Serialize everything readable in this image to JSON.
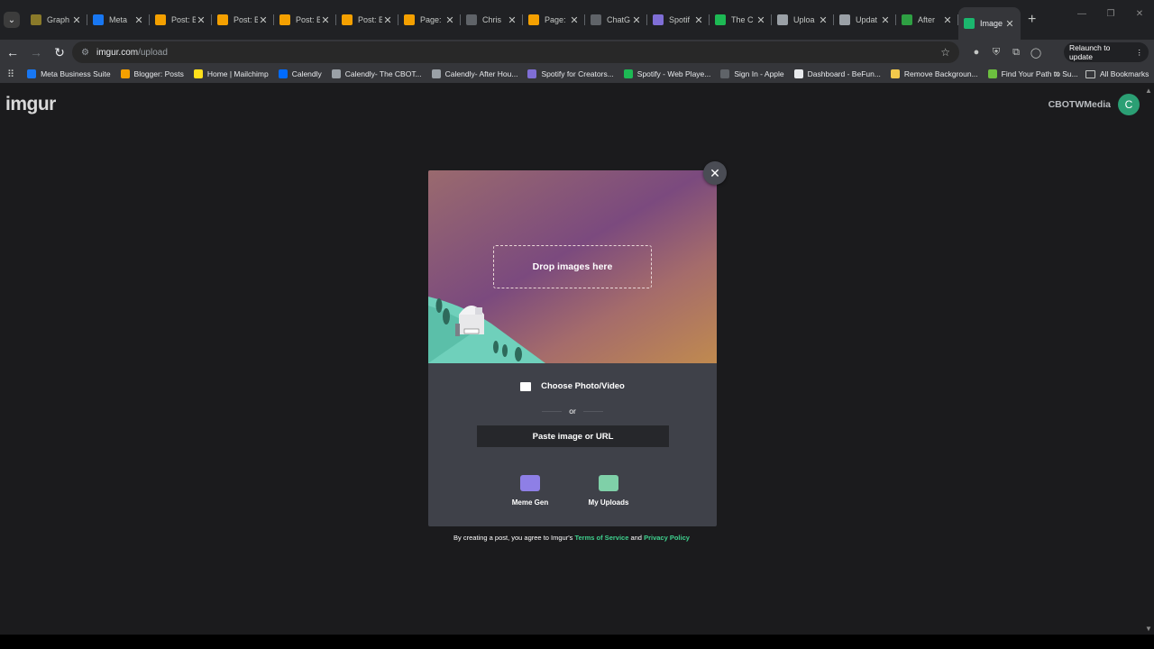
{
  "browser": {
    "tabs": [
      {
        "title": "Graph",
        "color": "#8a7a2a"
      },
      {
        "title": "Meta",
        "color": "#1877f2"
      },
      {
        "title": "Post: B",
        "color": "#f4a000"
      },
      {
        "title": "Post: B",
        "color": "#f4a000"
      },
      {
        "title": "Post: B",
        "color": "#f4a000"
      },
      {
        "title": "Post: B",
        "color": "#f4a000"
      },
      {
        "title": "Page:",
        "color": "#f4a000"
      },
      {
        "title": "Chris",
        "color": "#5f6368"
      },
      {
        "title": "Page:",
        "color": "#f4a000"
      },
      {
        "title": "ChatG",
        "color": "#5f6368"
      },
      {
        "title": "Spotif",
        "color": "#7f6ed6"
      },
      {
        "title": "The C",
        "color": "#1db954"
      },
      {
        "title": "Uploa",
        "color": "#9aa0a6"
      },
      {
        "title": "Updat",
        "color": "#9aa0a6"
      },
      {
        "title": "After",
        "color": "#2ea043"
      },
      {
        "title": "Image",
        "color": "#1bb76e"
      }
    ],
    "url_host": "imgur.com",
    "url_path": "/upload",
    "relaunch_label": "Relaunch to update",
    "bookmarks": [
      {
        "label": "Meta Business Suite",
        "color": "#1877f2"
      },
      {
        "label": "Blogger: Posts",
        "color": "#f4a000"
      },
      {
        "label": "Home | Mailchimp",
        "color": "#ffe01b"
      },
      {
        "label": "Calendly",
        "color": "#006bff"
      },
      {
        "label": "Calendly- The CBOT...",
        "color": "#9aa0a6"
      },
      {
        "label": "Calendly- After Hou...",
        "color": "#9aa0a6"
      },
      {
        "label": "Spotify for Creators...",
        "color": "#7f6ed6"
      },
      {
        "label": "Spotify - Web Playe...",
        "color": "#1db954"
      },
      {
        "label": "Sign In - Apple",
        "color": "#5f6368"
      },
      {
        "label": "Dashboard - BeFun...",
        "color": "#e8eaed"
      },
      {
        "label": "Remove Backgroun...",
        "color": "#f2c94c"
      },
      {
        "label": "Find Your Path to Su...",
        "color": "#6cbf3f"
      }
    ],
    "all_bookmarks_label": "All Bookmarks"
  },
  "page": {
    "logo": "imgur",
    "username": "CBOTWMedia",
    "avatar_initial": "C",
    "upload": {
      "drop_label": "Drop images here",
      "choose_label": "Choose Photo/Video",
      "or_label": "or",
      "paste_label": "Paste image or URL",
      "tools": [
        {
          "label": "Meme Gen",
          "icon": "meme-gen-icon"
        },
        {
          "label": "My Uploads",
          "icon": "my-uploads-icon"
        }
      ]
    },
    "terms": {
      "prefix": "By creating a post, you agree to Imgur's",
      "tos": "Terms of Service",
      "and": "and",
      "privacy": "Privacy Policy"
    }
  }
}
